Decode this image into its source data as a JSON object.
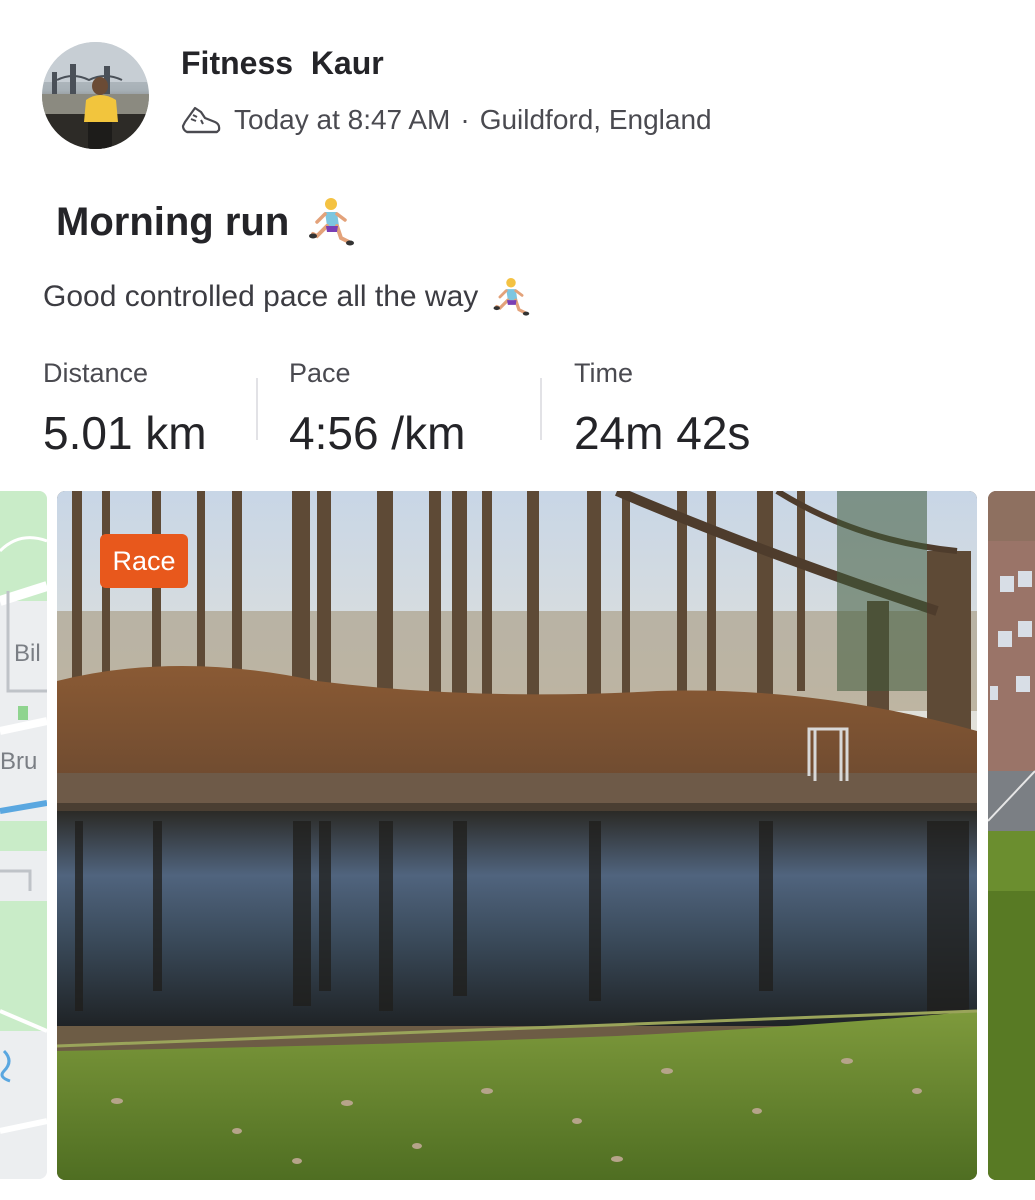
{
  "post": {
    "author": "Fitness  Kaur",
    "activity_icon": "running-shoe-icon",
    "time": "Today at 8:47 AM",
    "separator": "·",
    "location": "Guildford, England",
    "title": "Morning run",
    "description": "Good controlled pace all the way"
  },
  "stats": [
    {
      "label": "Distance",
      "value": "5.01 km"
    },
    {
      "label": "Pace",
      "value": "4:56 /km"
    },
    {
      "label": "Time",
      "value": "24m 42s"
    }
  ],
  "media": {
    "badge": "Race",
    "map_labels": [
      "Bil",
      "Bru"
    ]
  },
  "colors": {
    "accent": "#e8581c",
    "text": "#242428",
    "muted": "#4a4a50"
  }
}
